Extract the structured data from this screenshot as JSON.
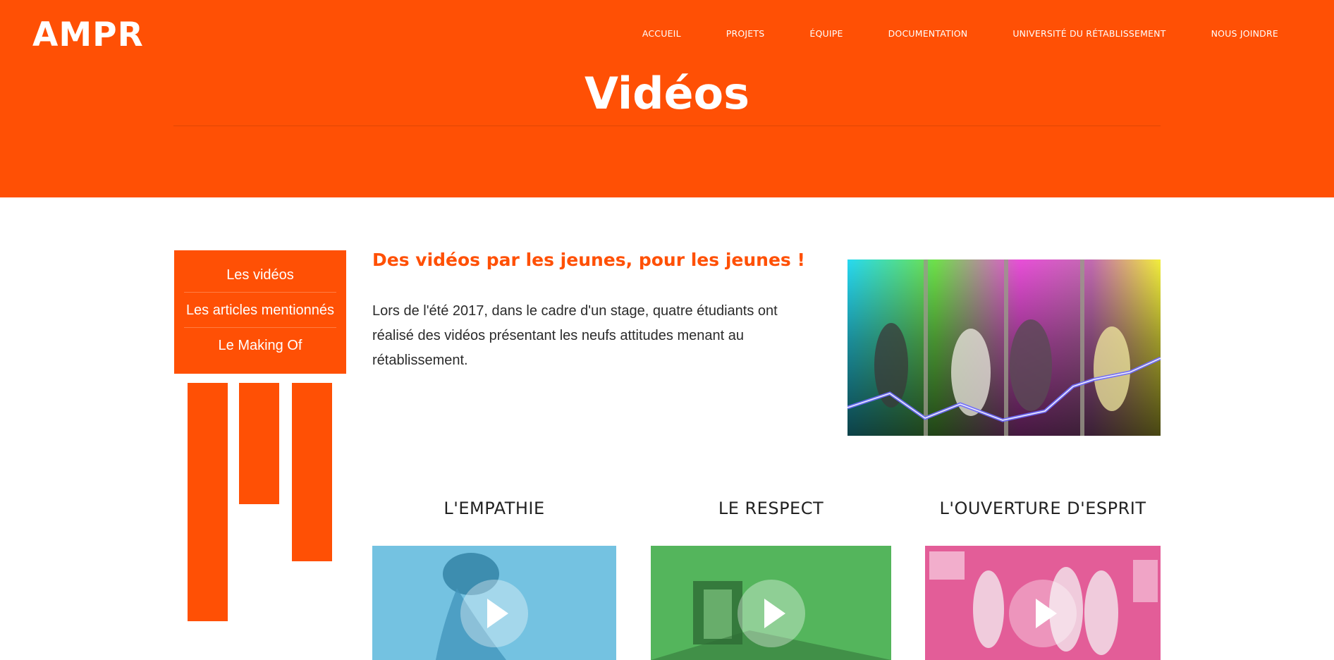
{
  "header": {
    "logo": "AMPR",
    "nav": [
      {
        "label": "ACCUEIL"
      },
      {
        "label": "PROJETS"
      },
      {
        "label": "ÉQUIPE"
      },
      {
        "label": "DOCUMENTATION"
      },
      {
        "label": "UNIVERSITÉ DU RÉTABLISSEMENT"
      },
      {
        "label": "NOUS JOINDRE"
      }
    ],
    "page_title": "Vidéos"
  },
  "sidebar": {
    "items": [
      {
        "label": "Les vidéos"
      },
      {
        "label": "Les articles mentionnés"
      },
      {
        "label": "Le Making Of"
      }
    ]
  },
  "intro": {
    "heading": "Des vidéos par les jeunes, pour les jeunes !",
    "text": "Lors de l'été 2017, dans le cadre d'un stage, quatre étudiants ont réalisé des vidéos présentant les neufs attitudes menant au rétablissement."
  },
  "videos": [
    {
      "title": "L'EMPATHIE",
      "tint": "#5fb8dc"
    },
    {
      "title": "LE RESPECT",
      "tint": "#3ea84a"
    },
    {
      "title": "L'OUVERTURE D'ESPRIT",
      "tint": "#df4a8c"
    }
  ],
  "colors": {
    "brand": "#ff5005"
  }
}
